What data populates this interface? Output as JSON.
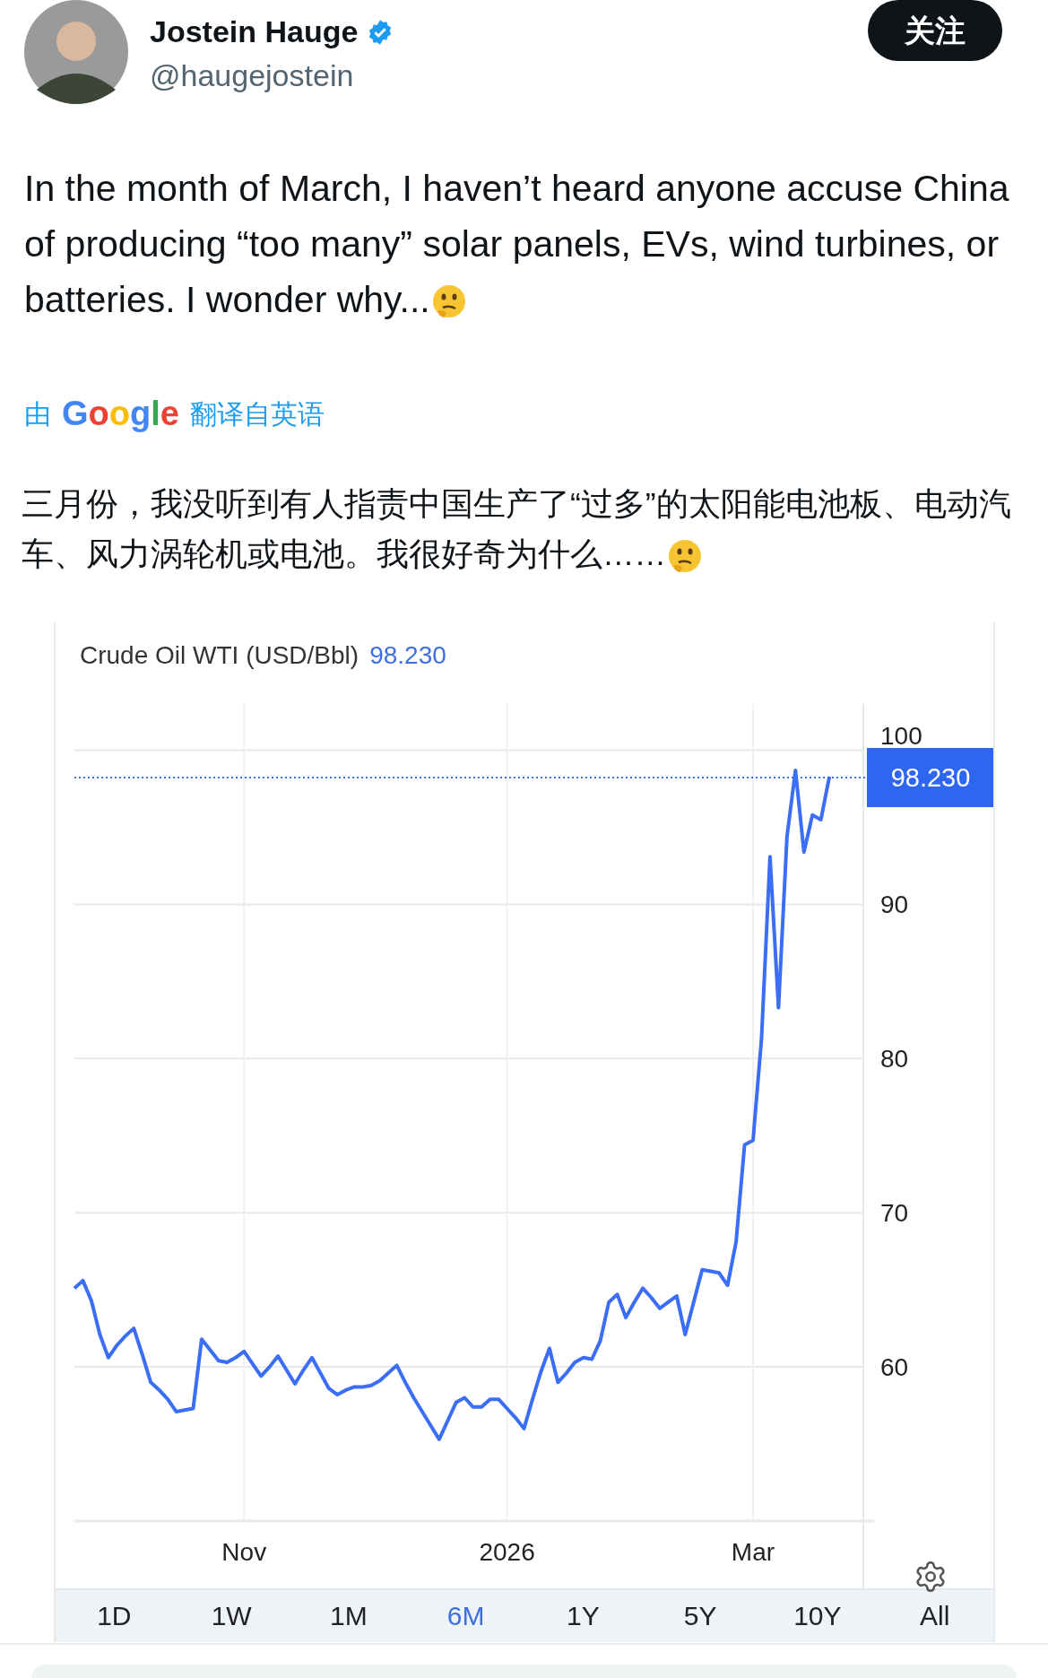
{
  "author": {
    "name": "Jostein Hauge",
    "handle": "@haugejostein",
    "verified": true
  },
  "follow_button": "关注",
  "tweet": {
    "text": "In the month of March, I haven’t heard anyone accuse China of producing “too many” solar panels, EVs, wind turbines, or batteries. I wonder why..."
  },
  "translation": {
    "prefix": "由",
    "brand": "Google",
    "suffix": "翻译自英语",
    "text": "三月份，我没听到有人指责中国生产了“过多”的太阳能电池板、电动汽车、风力涡轮机或电池。我很好奇为什么……"
  },
  "chart": {
    "title": "Crude Oil WTI (USD/Bbl)",
    "value": "98.230",
    "chart_data": {
      "type": "line",
      "categories": [
        null,
        null,
        null,
        null,
        null,
        null,
        null,
        null,
        null,
        null,
        null,
        null,
        null,
        null,
        null,
        null,
        null,
        null,
        null,
        null,
        "Nov",
        null,
        null,
        null,
        null,
        null,
        null,
        null,
        null,
        null,
        null,
        null,
        null,
        null,
        null,
        null,
        null,
        null,
        null,
        null,
        null,
        null,
        null,
        null,
        null,
        null,
        null,
        null,
        null,
        null,
        null,
        "2026",
        null,
        null,
        null,
        null,
        null,
        null,
        null,
        null,
        null,
        null,
        null,
        null,
        null,
        null,
        null,
        null,
        null,
        null,
        null,
        null,
        null,
        null,
        null,
        null,
        null,
        null,
        null,
        null,
        "Mar",
        null,
        null,
        null,
        null,
        null,
        null,
        null,
        null,
        null,
        null,
        null,
        null,
        null
      ],
      "series": [
        {
          "color": "#3b6ef5",
          "values": [
            65.1,
            65.6,
            64.3,
            62.1,
            60.6,
            61.4,
            62.0,
            62.5,
            60.8,
            59.0,
            58.5,
            57.9,
            57.1,
            57.2,
            57.3,
            61.8,
            61.1,
            60.4,
            60.3,
            60.6,
            61.0,
            60.2,
            59.4,
            60.0,
            60.7,
            59.8,
            58.9,
            59.8,
            60.6,
            59.6,
            58.6,
            58.2,
            58.5,
            58.7,
            58.7,
            58.8,
            59.1,
            59.6,
            60.1,
            59.0,
            58.0,
            57.1,
            56.2,
            55.3,
            56.5,
            57.7,
            58.0,
            57.4,
            57.4,
            57.9,
            57.9,
            57.3,
            56.7,
            56.0,
            57.9,
            59.7,
            61.2,
            59.0,
            59.6,
            60.3,
            60.6,
            60.5,
            61.7,
            64.2,
            64.7,
            63.2,
            64.2,
            65.1,
            64.5,
            63.8,
            64.2,
            64.6,
            62.1,
            64.2,
            66.3,
            66.2,
            66.1,
            65.3,
            68.1,
            74.4,
            74.7,
            81.3,
            93.1,
            83.3,
            94.4,
            98.7,
            93.4,
            95.8,
            95.5,
            98.3,
            null,
            null,
            null,
            null
          ]
        }
      ],
      "ylim": [
        50,
        103
      ],
      "grid": true,
      "ref_lines": [
        {
          "axis": "y",
          "value": 98.23,
          "label": "98.230",
          "color": "#3b6ef5"
        }
      ],
      "yticks": [
        60,
        70,
        80,
        90,
        100
      ]
    },
    "ranges": [
      {
        "label": "1D",
        "selected": false
      },
      {
        "label": "1W",
        "selected": false
      },
      {
        "label": "1M",
        "selected": false
      },
      {
        "label": "6M",
        "selected": true
      },
      {
        "label": "1Y",
        "selected": false
      },
      {
        "label": "5Y",
        "selected": false
      },
      {
        "label": "10Y",
        "selected": false
      },
      {
        "label": "All",
        "selected": false
      }
    ]
  }
}
